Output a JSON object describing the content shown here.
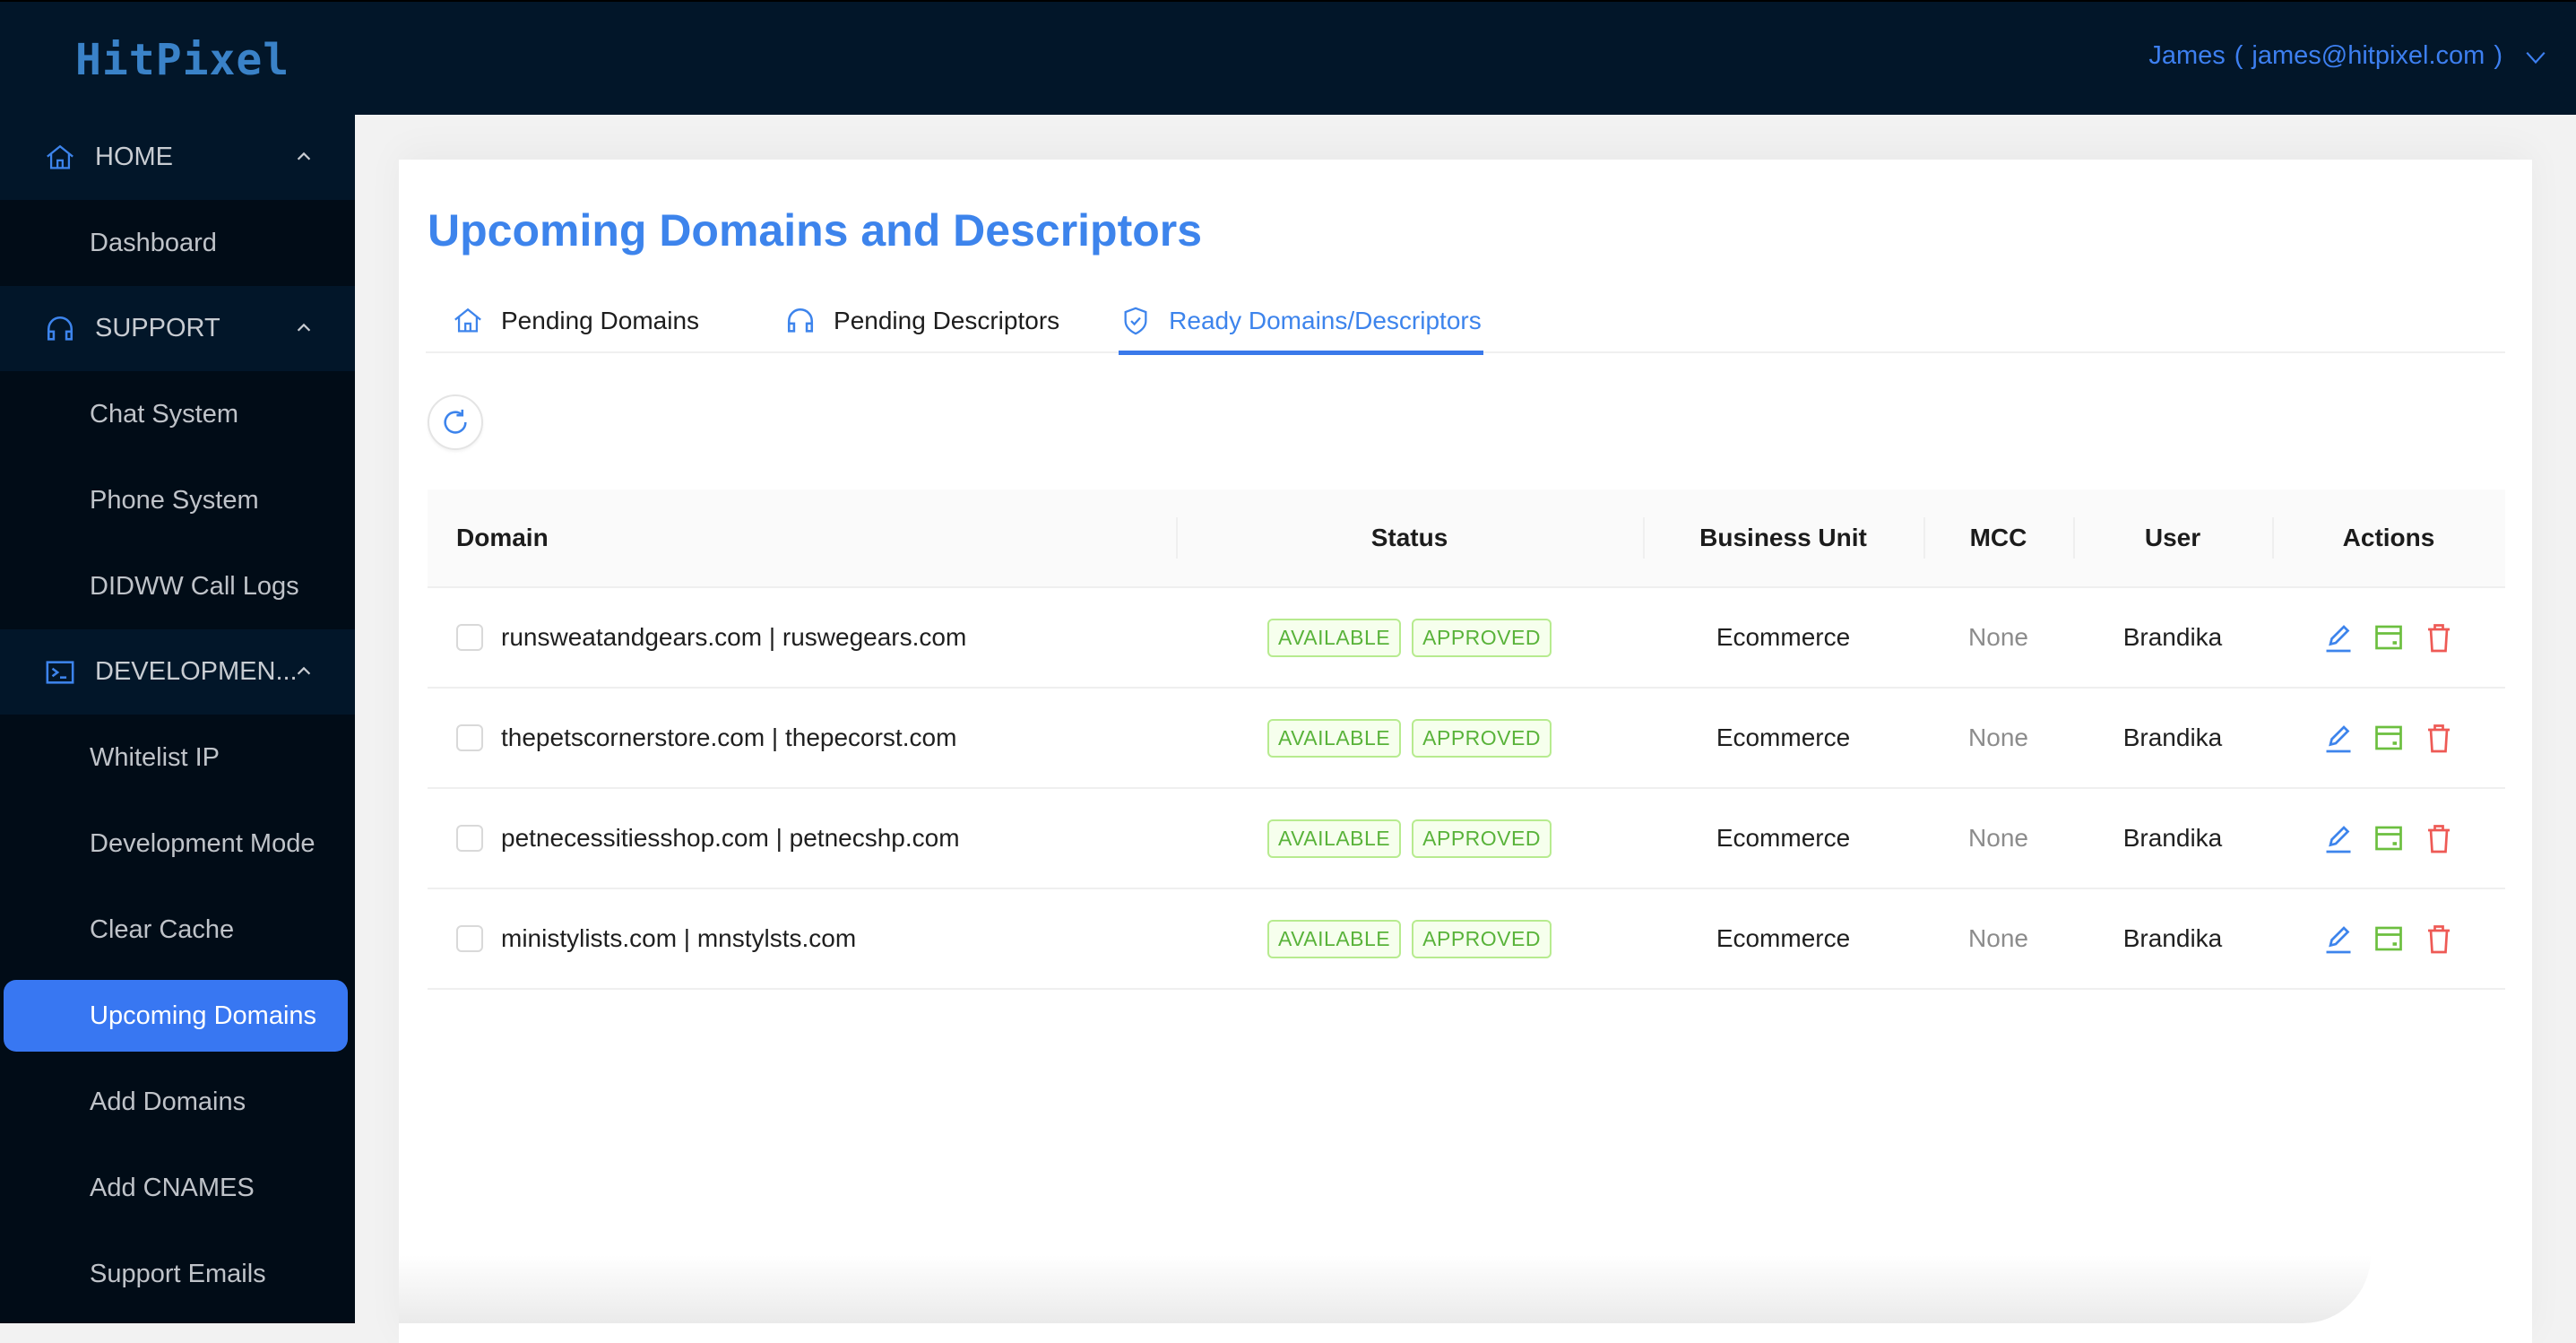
{
  "app": {
    "logo_text": "HitPixel",
    "brand_color": "#3a82c8",
    "accent_color": "#3877f2"
  },
  "header": {
    "user_name": "James",
    "user_email": "james@hitpixel.com",
    "open_paren": "(",
    "close_paren": ")",
    "dropdown_icon": "chevron-down-icon"
  },
  "sidebar": {
    "groups": [
      {
        "label": "HOME",
        "icon": "home-icon",
        "expanded": true,
        "items": [
          {
            "label": "Dashboard",
            "active": false
          }
        ]
      },
      {
        "label": "SUPPORT",
        "icon": "headphones-icon",
        "expanded": true,
        "items": [
          {
            "label": "Chat System",
            "active": false
          },
          {
            "label": "Phone System",
            "active": false
          },
          {
            "label": "DIDWW Call Logs",
            "active": false
          }
        ]
      },
      {
        "label": "DEVELOPMEN...",
        "icon": "terminal-icon",
        "expanded": true,
        "items": [
          {
            "label": "Whitelist IP",
            "active": false
          },
          {
            "label": "Development Mode",
            "active": false
          },
          {
            "label": "Clear Cache",
            "active": false
          },
          {
            "label": "Upcoming Domains",
            "active": true
          },
          {
            "label": "Add Domains",
            "active": false
          },
          {
            "label": "Add CNAMES",
            "active": false
          },
          {
            "label": "Support Emails",
            "active": false
          }
        ]
      }
    ]
  },
  "main": {
    "title": "Upcoming Domains and Descriptors",
    "tabs": [
      {
        "label": "Pending Domains",
        "icon": "home-icon",
        "active": false
      },
      {
        "label": "Pending Descriptors",
        "icon": "headphones-icon",
        "active": false
      },
      {
        "label": "Ready Domains/Descriptors",
        "icon": "shield-check-icon",
        "active": true
      }
    ],
    "refresh_icon": "refresh-icon",
    "table": {
      "columns": [
        "Domain",
        "Status",
        "Business Unit",
        "MCC",
        "User",
        "Actions"
      ],
      "rows": [
        {
          "domain": "runsweatandgears.com | ruswegears.com",
          "statuses": [
            "AVAILABLE",
            "APPROVED"
          ],
          "business_unit": "Ecommerce",
          "mcc": "None",
          "user": "Brandika",
          "checked": false
        },
        {
          "domain": "thepetscornerstore.com | thepecorst.com",
          "statuses": [
            "AVAILABLE",
            "APPROVED"
          ],
          "business_unit": "Ecommerce",
          "mcc": "None",
          "user": "Brandika",
          "checked": false
        },
        {
          "domain": "petnecessitiesshop.com | petnecshp.com",
          "statuses": [
            "AVAILABLE",
            "APPROVED"
          ],
          "business_unit": "Ecommerce",
          "mcc": "None",
          "user": "Brandika",
          "checked": false
        },
        {
          "domain": "ministylists.com | mnstylsts.com",
          "statuses": [
            "AVAILABLE",
            "APPROVED"
          ],
          "business_unit": "Ecommerce",
          "mcc": "None",
          "user": "Brandika",
          "checked": false
        }
      ],
      "action_icons": [
        "edit-icon",
        "credit-card-icon",
        "delete-icon"
      ],
      "action_colors": {
        "edit": "#3d84ec",
        "card": "#6cbf3f",
        "delete": "#ee5a55"
      }
    }
  }
}
